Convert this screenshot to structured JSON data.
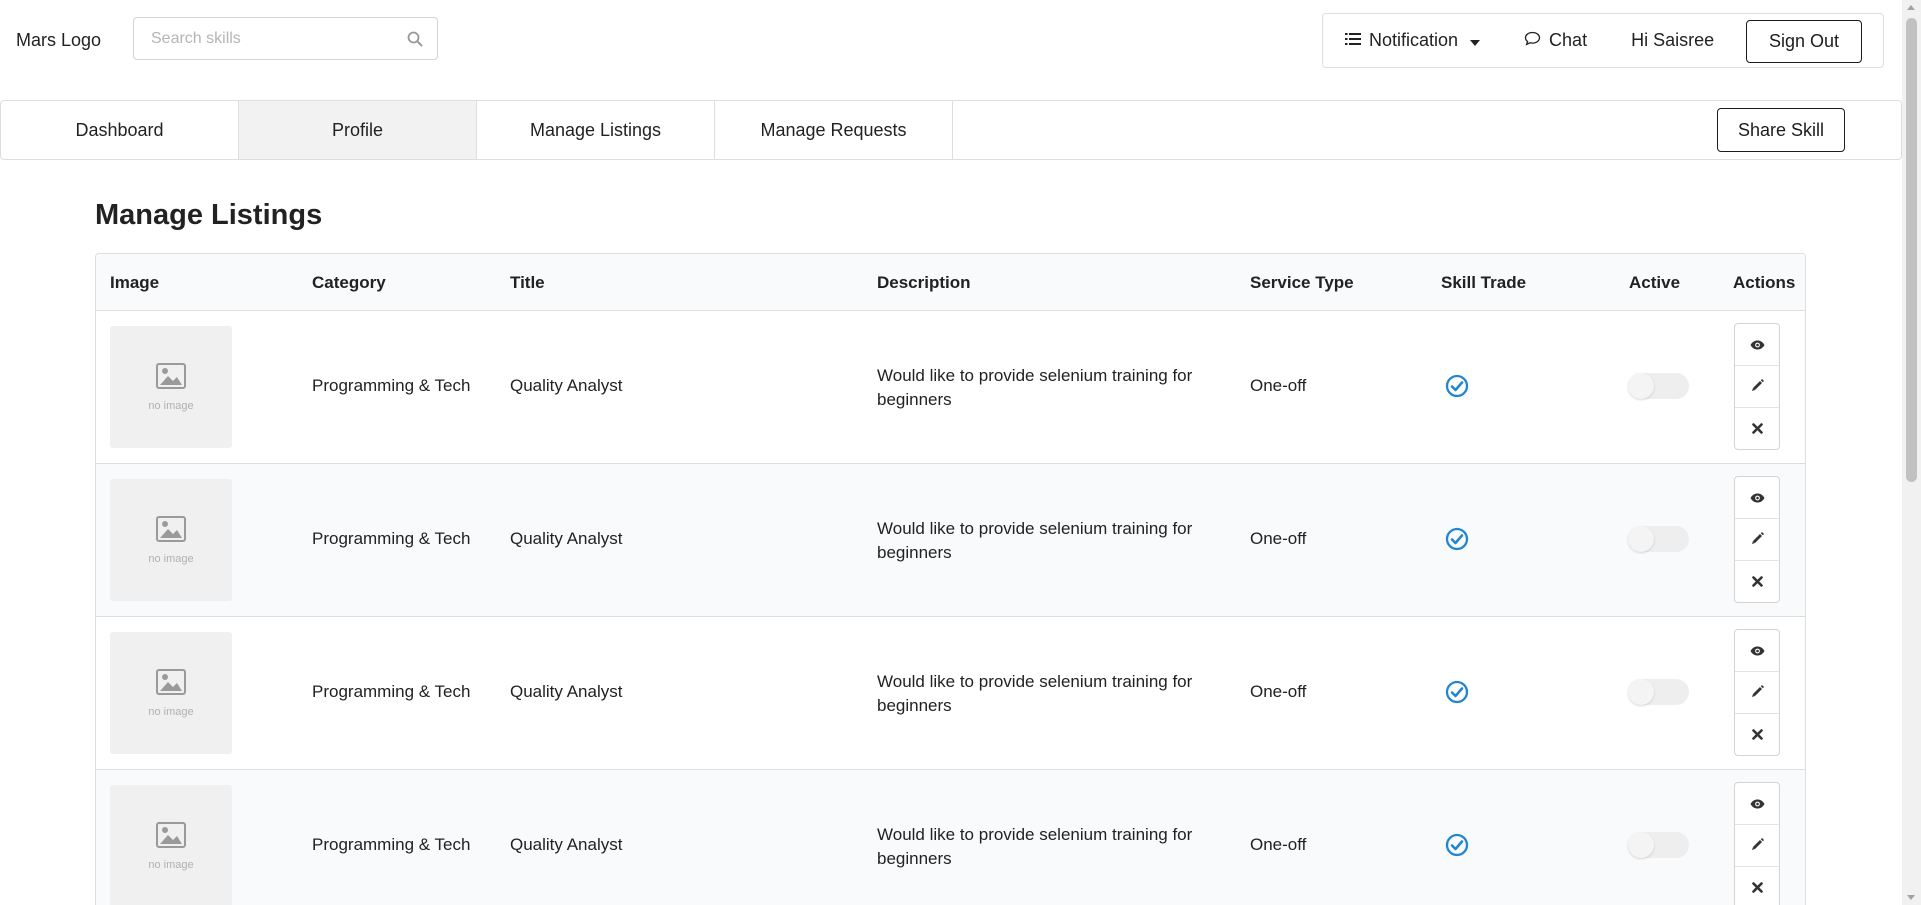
{
  "header": {
    "logo": "Mars Logo",
    "search": {
      "placeholder": "Search skills",
      "value": ""
    },
    "user_menu": {
      "notification": "Notification",
      "chat": "Chat",
      "greeting": "Hi Saisree",
      "sign_out": "Sign Out"
    }
  },
  "nav": {
    "tabs": [
      {
        "label": "Dashboard",
        "active": false
      },
      {
        "label": "Profile",
        "active": true
      },
      {
        "label": "Manage Listings",
        "active": false
      },
      {
        "label": "Manage Requests",
        "active": false
      }
    ],
    "share_skill": "Share Skill"
  },
  "page": {
    "title": "Manage Listings"
  },
  "table": {
    "columns": [
      "Image",
      "Category",
      "Title",
      "Description",
      "Service Type",
      "Skill Trade",
      "Active",
      "Actions"
    ],
    "rows": [
      {
        "image_text": "no image",
        "category": "Programming & Tech",
        "title": "Quality Analyst",
        "description": "Would like to provide selenium training for beginners",
        "service_type": "One-off",
        "skill_trade": true,
        "active": false
      },
      {
        "image_text": "no image",
        "category": "Programming & Tech",
        "title": "Quality Analyst",
        "description": "Would like to provide selenium training for beginners",
        "service_type": "One-off",
        "skill_trade": true,
        "active": false
      },
      {
        "image_text": "no image",
        "category": "Programming & Tech",
        "title": "Quality Analyst",
        "description": "Would like to provide selenium training for beginners",
        "service_type": "One-off",
        "skill_trade": true,
        "active": false
      },
      {
        "image_text": "no image",
        "category": "Programming & Tech",
        "title": "Quality Analyst",
        "description": "Would like to provide selenium training for beginners",
        "service_type": "One-off",
        "skill_trade": true,
        "active": false
      }
    ]
  },
  "icons": {
    "search": "search-icon",
    "notification": "list-icon",
    "notification_caret": "caret-down-icon",
    "chat": "chat-bubble-icon",
    "placeholder_image": "image-icon",
    "skill_trade": "check-circle-icon",
    "view": "eye-icon",
    "edit": "pencil-icon",
    "delete": "close-icon"
  },
  "colors": {
    "accent": "#2185d0",
    "border": "#dededf",
    "header_bg": "#f9fafb",
    "active_tab_bg": "#f2f2f2"
  }
}
